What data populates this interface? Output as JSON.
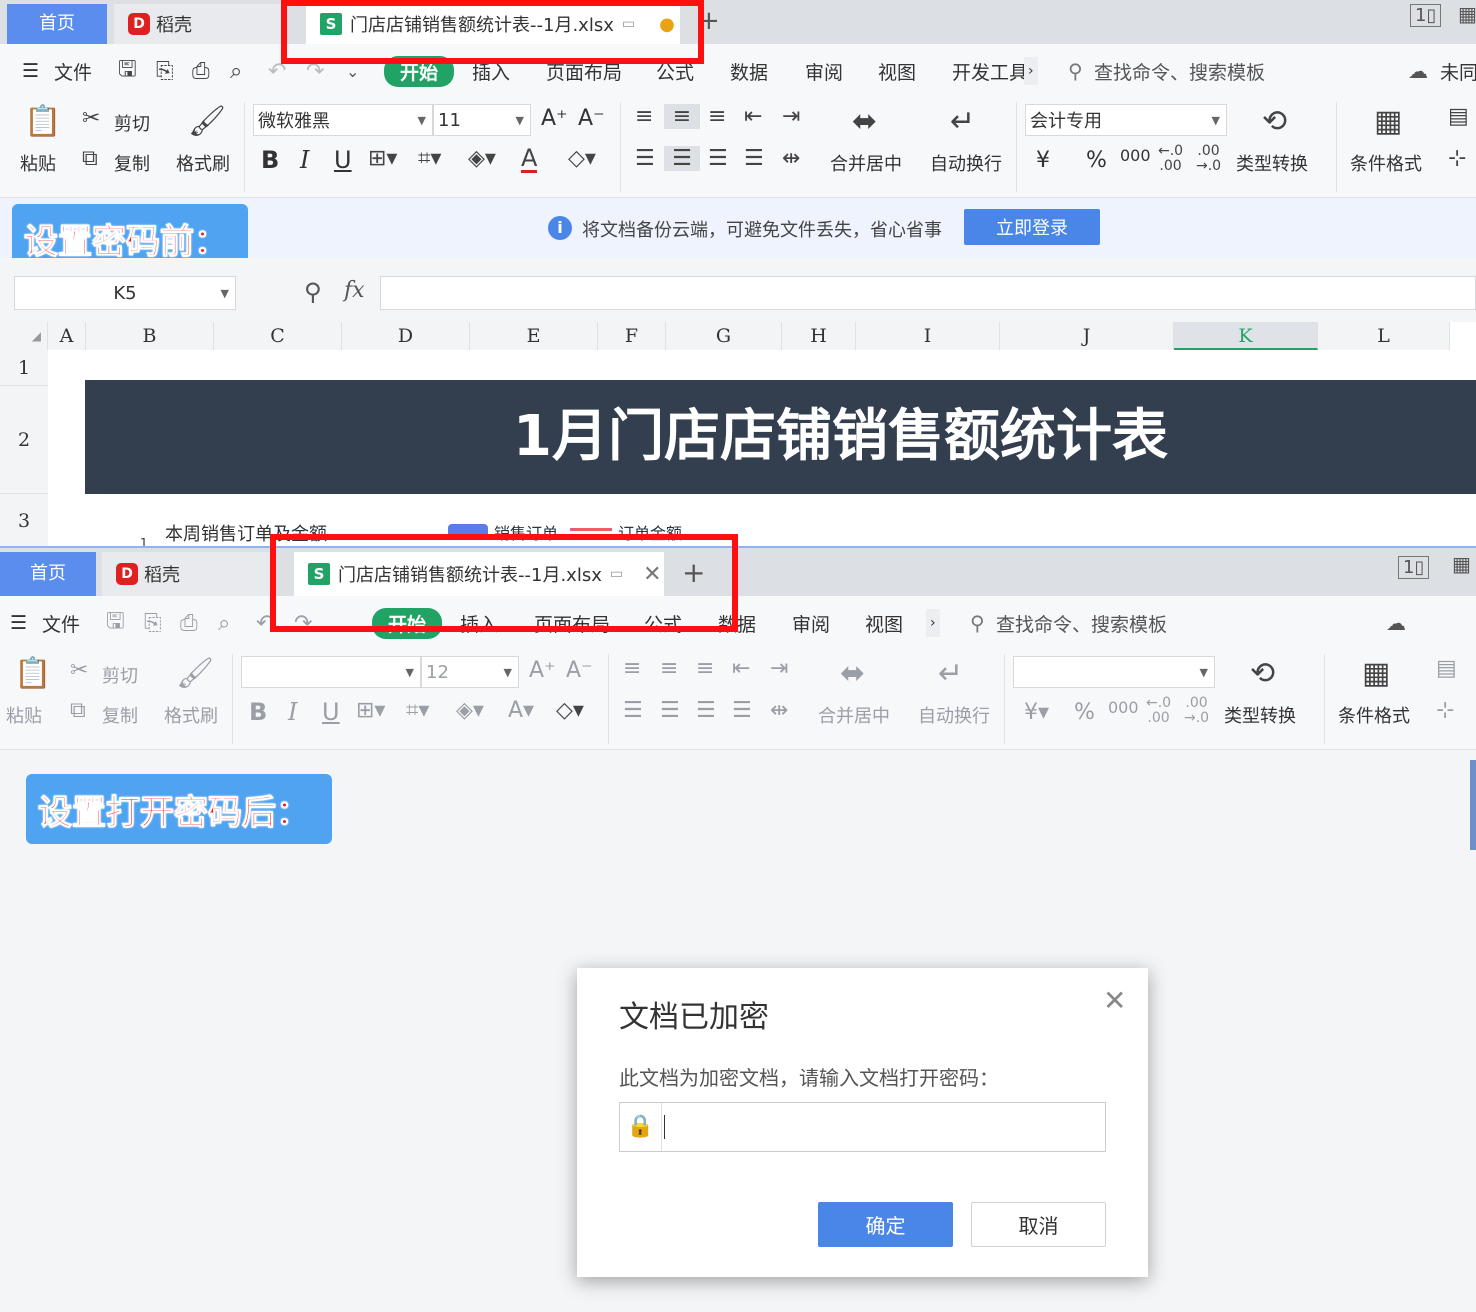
{
  "colors": {
    "accent": "#4a86e8",
    "highlight_box": "#ff1010",
    "title_banner_bg": "#333f4f",
    "start_tab": "#21a366",
    "callout_bg": "#4fa3f0"
  },
  "top": {
    "tabs": {
      "home": "首页",
      "daoke": "稻壳",
      "file": "门店店铺销售额统计表--1月.xlsx",
      "add": "+"
    },
    "menu": {
      "file": "文件",
      "start": "开始",
      "insert": "插入",
      "layout": "页面布局",
      "formula": "公式",
      "data": "数据",
      "review": "审阅",
      "view": "视图",
      "dev": "开发工具",
      "more": "›",
      "search": "查找命令、搜索模板",
      "sync": "未同"
    },
    "toolbar": {
      "paste": "粘贴",
      "cut": "剪切",
      "copy": "复制",
      "format_painter": "格式刷",
      "font_name": "微软雅黑",
      "font_size": "11",
      "merge": "合并居中",
      "wrap": "自动换行",
      "number_format": "会计专用",
      "type_convert": "类型转换",
      "cond_format": "条件格式",
      "bold": "B",
      "italic": "I",
      "underline": "U",
      "font_color": "A",
      "increase_font": "A⁺",
      "decrease_font": "A⁻",
      "currency": "¥",
      "percent": "%",
      "thousands": "000"
    },
    "callout": "设置密码前：",
    "backup": {
      "text": "将文档备份云端，可避免文件丢失，省心省事",
      "button": "立即登录"
    },
    "formula_bar": {
      "cell": "K5",
      "fx": "fx"
    },
    "columns": [
      "A",
      "B",
      "C",
      "D",
      "E",
      "F",
      "G",
      "H",
      "I",
      "J",
      "K",
      "L"
    ],
    "rows": [
      "1",
      "2",
      "3"
    ],
    "sheet_title": "1月门店店铺销售额统计表",
    "chart_caption": "本周销售订单及金额",
    "legend": {
      "orders": "销售订单",
      "amount": "订单金额"
    }
  },
  "bottom": {
    "tabs": {
      "home": "首页",
      "daoke": "稻壳",
      "file": "门店店铺销售额统计表--1月.xlsx",
      "add": "+"
    },
    "menu": {
      "file": "文件",
      "start": "开始",
      "insert": "插入",
      "layout": "页面布局",
      "formula": "公式",
      "data": "数据",
      "review": "审阅",
      "view": "视图",
      "more": "›",
      "search": "查找命令、搜索模板"
    },
    "toolbar": {
      "paste": "粘贴",
      "cut": "剪切",
      "copy": "复制",
      "format_painter": "格式刷",
      "font_size": "12",
      "merge": "合并居中",
      "wrap": "自动换行",
      "type_convert": "类型转换",
      "cond_format": "条件格式"
    },
    "callout": "设置打开密码后："
  },
  "dialog": {
    "title": "文档已加密",
    "message": "此文档为加密文档，请输入文档打开密码：",
    "confirm": "确定",
    "cancel": "取消"
  }
}
